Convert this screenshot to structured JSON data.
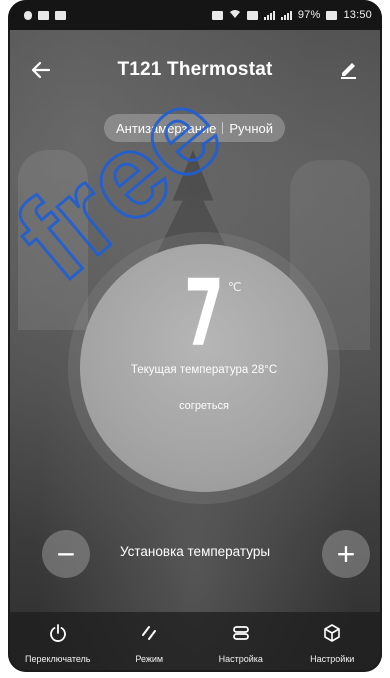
{
  "status_bar": {
    "battery": "97%",
    "time": "13:50"
  },
  "header": {
    "title": "T121 Thermostat"
  },
  "mode": {
    "left": "Антизамерзание",
    "right": "Ручной"
  },
  "dial": {
    "set_temp": "7",
    "unit": "℃",
    "current_temp": "Текущая температура 28°C",
    "status": "согреться"
  },
  "controls": {
    "minus": "−",
    "plus": "+",
    "setpoint_label": "Установка температуры"
  },
  "nav": [
    {
      "label": "Переключатель",
      "icon": "power-icon"
    },
    {
      "label": "Режим",
      "icon": "mode-icon"
    },
    {
      "label": "Настройка",
      "icon": "adjust-icon"
    },
    {
      "label": "Настройки",
      "icon": "settings-cube-icon"
    }
  ],
  "watermark": {
    "text": "free",
    "color": "#1f5fd6"
  }
}
